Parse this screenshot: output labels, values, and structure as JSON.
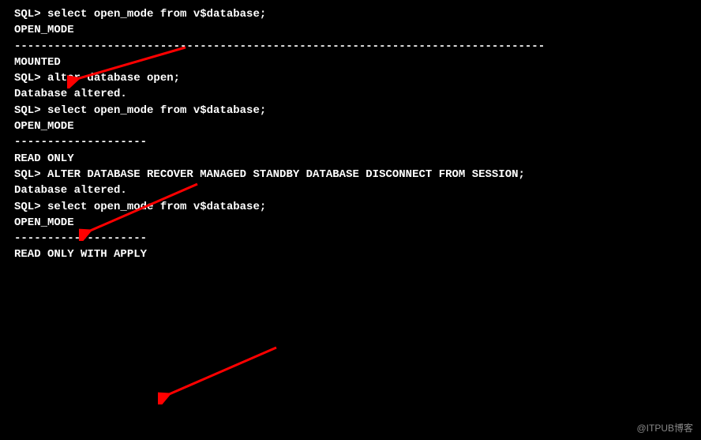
{
  "terminal": {
    "lines": [
      "SQL> select open_mode from v$database;",
      "",
      "OPEN_MODE",
      "--------------------------------------------------------------------------------",
      "MOUNTED",
      "",
      "SQL> alter database open;",
      "",
      "Database altered.",
      "",
      "SQL> select open_mode from v$database;",
      "",
      "OPEN_MODE",
      "--------------------",
      "READ ONLY",
      "",
      "SQL> ALTER DATABASE RECOVER MANAGED STANDBY DATABASE DISCONNECT FROM SESSION;",
      "",
      "Database altered.",
      "",
      "SQL> select open_mode from v$database;",
      "",
      "OPEN_MODE",
      "--------------------",
      "READ ONLY WITH APPLY"
    ]
  },
  "watermark": "@ITPUB博客",
  "annotations": {
    "arrow_color": "#ff0000",
    "arrows": [
      {
        "target": "MOUNTED"
      },
      {
        "target": "READ ONLY"
      },
      {
        "target": "READ ONLY WITH APPLY"
      }
    ]
  }
}
